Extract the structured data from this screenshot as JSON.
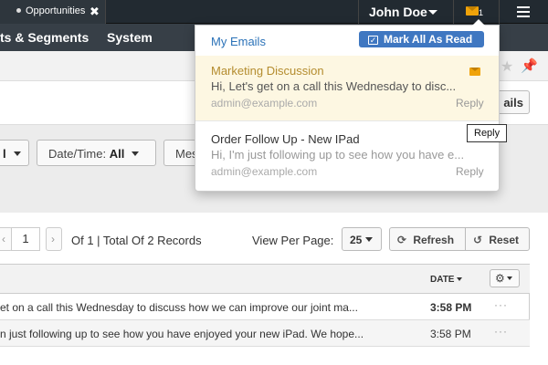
{
  "topbar": {
    "tab_label": "Opportunities",
    "user_name": "John Doe",
    "mail_count": "1"
  },
  "nav": {
    "items": [
      "ts & Segments",
      "System"
    ]
  },
  "header": {
    "emails_button_label": "ails"
  },
  "filters": {
    "first_label": "l",
    "datetime_label": "Date/Time:",
    "datetime_value": "All",
    "third_label": "Mes"
  },
  "pager": {
    "current_page": "1",
    "summary": "Of 1 | Total Of 2 Records",
    "view_per_page_label": "View Per Page:",
    "view_per_page_value": "25",
    "refresh_label": "Refresh",
    "reset_label": "Reset"
  },
  "table": {
    "date_column": "DATE",
    "rows": [
      {
        "text": "et on a call this Wednesday to discuss how we can improve our joint ma...",
        "time": "3:58 PM",
        "bold": true
      },
      {
        "text": "n just following up to see how you have enjoyed your new iPad. We hope...",
        "time": "3:58 PM",
        "bold": false
      }
    ]
  },
  "dropdown": {
    "title": "My Emails",
    "mark_all_label": "Mark All As Read",
    "items": [
      {
        "subject": "Marketing Discussion",
        "preview": "Hi, Let's get on a call this Wednesday to disc...",
        "sender": "admin@example.com",
        "reply_label": "Reply"
      },
      {
        "subject": "Order Follow Up - New IPad",
        "preview": "Hi, I'm just following up to see how you have e...",
        "sender": "admin@example.com",
        "reply_label": "Reply"
      }
    ]
  },
  "tooltip": {
    "text": "Reply"
  },
  "colors": {
    "topbar": "#222a31",
    "navbar": "#373f47",
    "accent_blue": "#3f77c1",
    "unread_bg": "#fdf7e2",
    "mail_icon": "#f0a30a"
  }
}
